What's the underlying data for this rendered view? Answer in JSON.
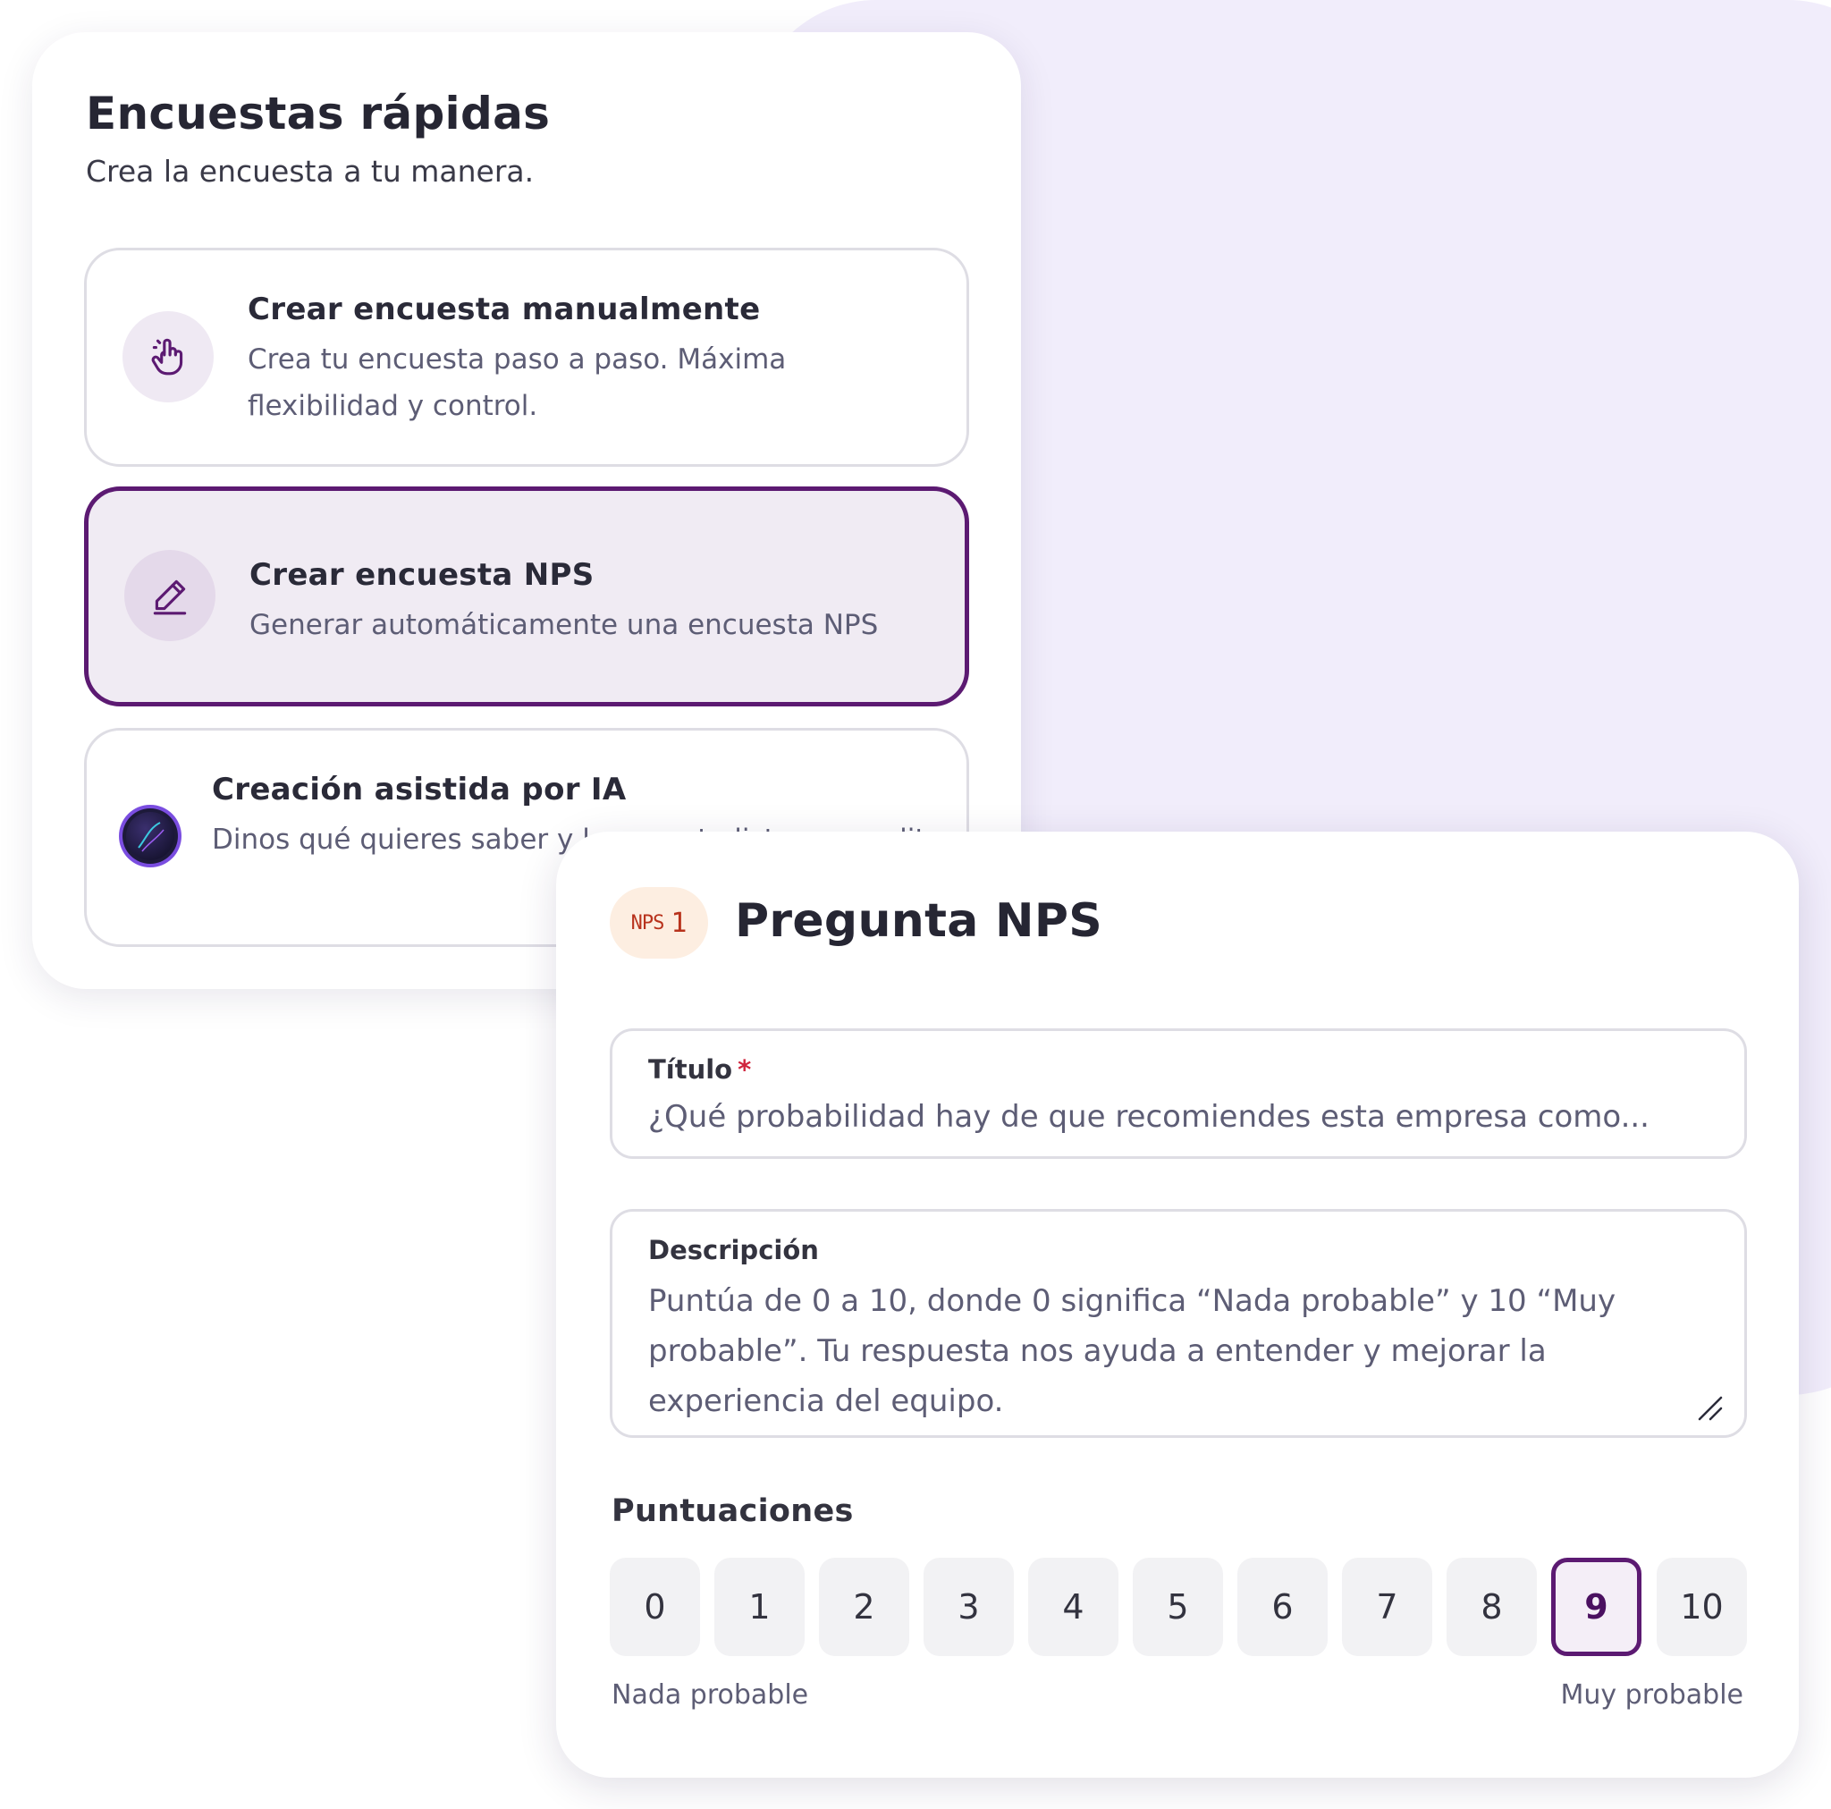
{
  "quick_surveys": {
    "title": "Encuestas rápidas",
    "subtitle": "Crea la encuesta a tu manera.",
    "options": [
      {
        "title": "Crear encuesta manualmente",
        "description": "Crea tu encuesta paso a paso. Máxima flexibilidad y control.",
        "icon": "pointer-hand-icon",
        "selected": false
      },
      {
        "title": "Crear encuesta NPS",
        "description": "Generar automáticamente una encuesta NPS",
        "icon": "pencil-icon",
        "selected": true
      },
      {
        "title": "Creación asistida por IA",
        "description": "Dinos qué quieres saber y l encuesta lista para edit",
        "icon": "ai-orb-icon",
        "selected": false
      }
    ]
  },
  "nps_question": {
    "badge_label": "NPS",
    "badge_number": "1",
    "title": "Pregunta NPS",
    "title_field": {
      "label": "Título",
      "required_marker": "*",
      "value": "¿Qué probabilidad hay de que recomiendes esta empresa como..."
    },
    "description_field": {
      "label": "Descripción",
      "value": "Puntúa de 0 a 10, donde 0 significa “Nada probable” y 10 “Muy probable”. Tu respuesta nos ayuda a entender y mejorar la experiencia del equipo."
    },
    "scores_label": "Puntuaciones",
    "scores": [
      "0",
      "1",
      "2",
      "3",
      "4",
      "5",
      "6",
      "7",
      "8",
      "9",
      "10"
    ],
    "selected_score": "9",
    "scale_min_label": "Nada probable",
    "scale_max_label": "Muy probable"
  },
  "colors": {
    "accent": "#5c1a72",
    "selected_background": "#f0ebf3",
    "background_blob": "#f1edfb",
    "badge_background": "#fdeee1",
    "badge_text": "#b8321c",
    "required": "#d0263e"
  }
}
